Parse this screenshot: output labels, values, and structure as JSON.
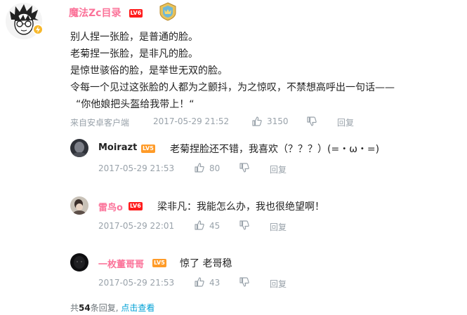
{
  "comment": {
    "username": "魔法Zc目录",
    "level": "LV6",
    "content_lines": [
      "别人捏一张脸，是普通的脸。",
      "老菊捏一张脸，是非凡的脸。",
      "是惊世骇俗的脸，是举世无双的脸。",
      "令每一个见过这张脸的人都为之颤抖，为之惊叹，不禁想高呼出一句话——",
      "“你他娘把头盔给我带上！“"
    ],
    "source": "来自安卓客户端",
    "time": "2017-05-29 21:52",
    "likes": "3150",
    "reply_label": "回复"
  },
  "replies": [
    {
      "username": "Moirazt",
      "name_color": "#222222",
      "level": "LV5",
      "level_color": "orange",
      "text": "老菊捏脸还不错，我喜欢（？？？）(=・ω・=)",
      "time": "2017-05-29 21:53",
      "likes": "80",
      "reply_label": "回复"
    },
    {
      "username": "雷鸟o",
      "name_color": "#fb7299",
      "level": "LV6",
      "level_color": "red",
      "text": "梁非凡：我能怎么办，我也很绝望啊！",
      "time": "2017-05-29 22:01",
      "likes": "45",
      "reply_label": "回复"
    },
    {
      "username": "一枚董哥哥",
      "name_color": "#fb7299",
      "level": "LV5",
      "level_color": "orange",
      "text": "惊了 老哥稳",
      "time": "2017-05-29 21:53",
      "likes": "43",
      "reply_label": "回复"
    }
  ],
  "footer": {
    "prefix": "共",
    "count": "54",
    "suffix": "条回复,",
    "link": "点击查看"
  }
}
